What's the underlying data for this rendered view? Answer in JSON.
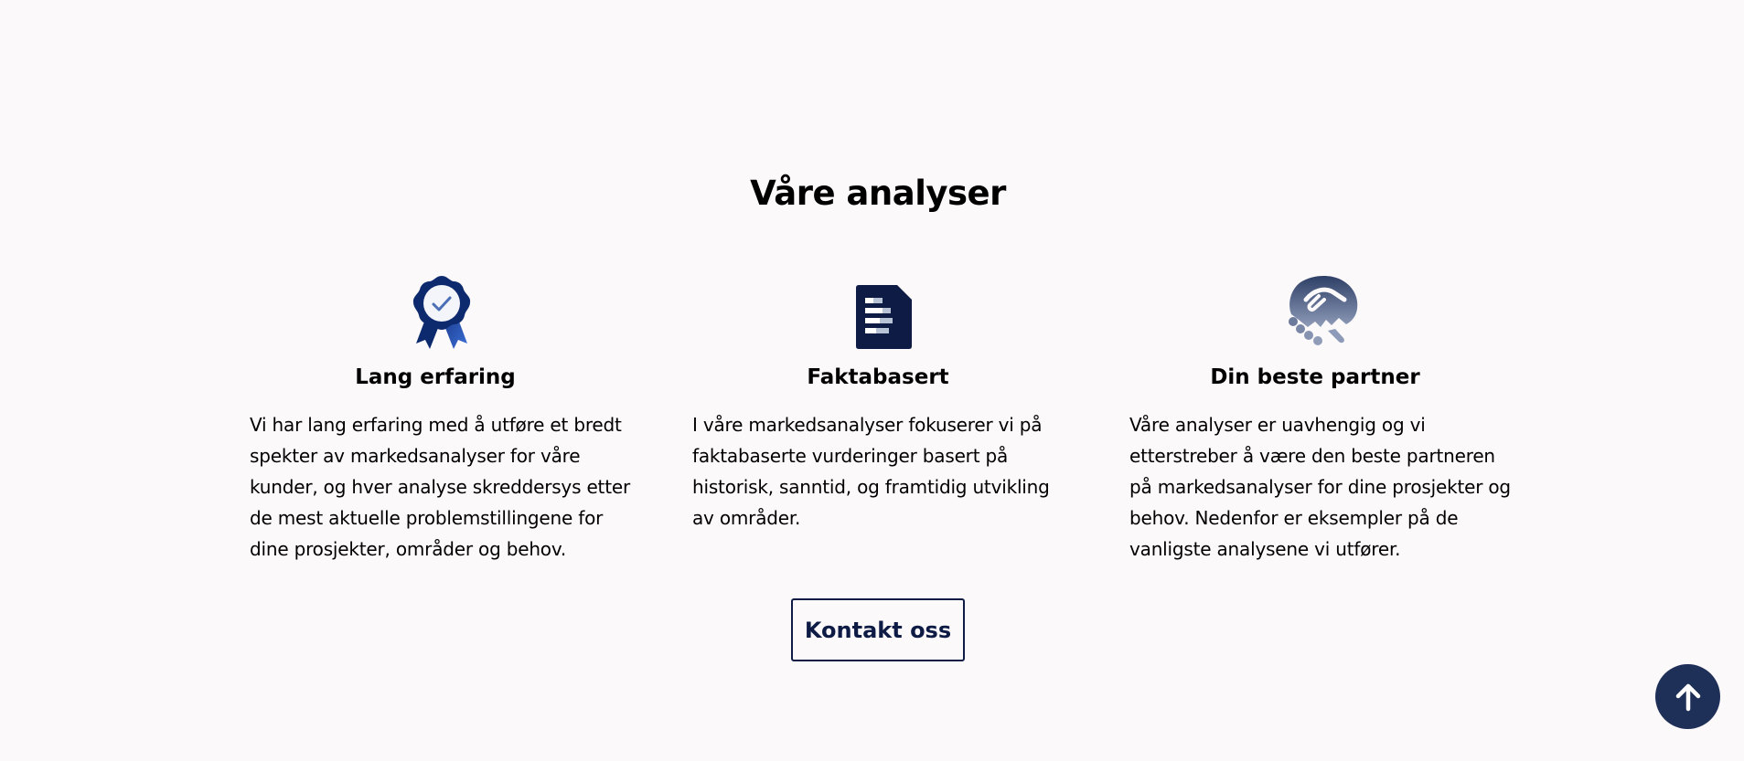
{
  "section": {
    "heading": "Våre analyser"
  },
  "features": [
    {
      "icon": "award-ribbon-icon",
      "title": "Lang erfaring",
      "text": "Vi har lang erfaring med å utføre et bredt spekter av markedsanalyser for våre kunder, og hver analyse skreddersys etter de mest aktuelle problemstillingene for dine prosjekter, områder og behov."
    },
    {
      "icon": "document-icon",
      "title": "Faktabasert",
      "text": "I våre markedsanalyser fokuserer vi på faktabaserte vurderinger basert på historisk, sanntid, og framtidig utvikling av områder."
    },
    {
      "icon": "handshake-icon",
      "title": "Din beste partner",
      "text": "Våre analyser er uavhengig og vi etterstreber å være den beste partneren på markedsanalyser for dine prosjekter og behov. Nedenfor er eksempler på de vanligste analysene vi utfører."
    }
  ],
  "cta": {
    "label": "Kontakt oss"
  },
  "scroll_top": {
    "icon": "arrow-up-icon"
  },
  "colors": {
    "background": "#fcf9fb",
    "primary": "#0d1b45",
    "scroll_button": "#1e2f58"
  }
}
